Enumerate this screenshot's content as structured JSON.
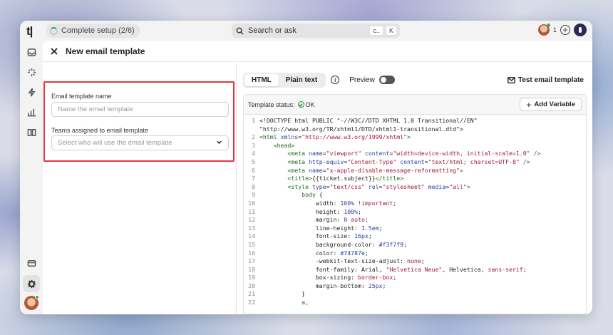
{
  "topbar": {
    "logo": "t|",
    "setup_label": "Complete setup (2/6)",
    "search_label": "Search or ask",
    "search_key1": "c..",
    "search_key2": "K",
    "notification_count": "1"
  },
  "panel": {
    "title": "New email template"
  },
  "form": {
    "name_label": "Email template name",
    "name_placeholder": "Name the email template",
    "teams_label": "Teams assigned to email template",
    "teams_placeholder": "Select who will use the email template"
  },
  "editor": {
    "tabs": [
      "HTML",
      "Plain text"
    ],
    "active_tab": "HTML",
    "preview_label": "Preview",
    "preview_enabled": false,
    "test_button": "Test email template",
    "status_label": "Template status:",
    "status_value": "OK",
    "add_variable_label": "Add Variable"
  },
  "code_lines": [
    {
      "n": "1",
      "segs": [
        [
          "<!DOCTYPE html PUBLIC \"-//W3C//DTD XHTML 1.0 Transitional//EN\"",
          "lc"
        ]
      ]
    },
    {
      "n": "",
      "segs": [
        [
          "\"http://www.w3.org/TR/xhtml1/DTD/xhtml1-transitional.dtd\">",
          "lc"
        ]
      ]
    },
    {
      "n": "2",
      "segs": [
        [
          "<html ",
          "t"
        ],
        [
          "xmlns",
          "a"
        ],
        [
          "=",
          "lc"
        ],
        [
          "\"http://www.w3.org/1999/xhtml\"",
          "s"
        ],
        [
          ">",
          "t"
        ]
      ]
    },
    {
      "n": "3",
      "segs": [
        [
          "    <head>",
          "t"
        ]
      ]
    },
    {
      "n": "4",
      "segs": [
        [
          "        <meta ",
          "t"
        ],
        [
          "name",
          "a"
        ],
        [
          "=",
          "lc"
        ],
        [
          "\"viewport\"",
          "s"
        ],
        [
          " content",
          "a"
        ],
        [
          "=",
          "lc"
        ],
        [
          "\"width=device-width, initial-scale=1.0\"",
          "s"
        ],
        [
          " />",
          "t"
        ]
      ]
    },
    {
      "n": "5",
      "segs": [
        [
          "        <meta ",
          "t"
        ],
        [
          "http-equiv",
          "a"
        ],
        [
          "=",
          "lc"
        ],
        [
          "\"Content-Type\"",
          "s"
        ],
        [
          " content",
          "a"
        ],
        [
          "=",
          "lc"
        ],
        [
          "\"text/html; charset=UTF-8\"",
          "s"
        ],
        [
          " />",
          "t"
        ]
      ]
    },
    {
      "n": "6",
      "segs": [
        [
          "        <meta ",
          "t"
        ],
        [
          "name",
          "a"
        ],
        [
          "=",
          "lc"
        ],
        [
          "\"x-apple-disable-message-reformatting\"",
          "s"
        ],
        [
          ">",
          "t"
        ]
      ]
    },
    {
      "n": "7",
      "segs": [
        [
          "        <title>",
          "t"
        ],
        [
          "{{ticket.subject}}",
          "lc"
        ],
        [
          "</title>",
          "t"
        ]
      ]
    },
    {
      "n": "8",
      "segs": [
        [
          "        <style ",
          "t"
        ],
        [
          "type",
          "a"
        ],
        [
          "=",
          "lc"
        ],
        [
          "\"text/css\"",
          "s"
        ],
        [
          " rel",
          "a"
        ],
        [
          "=",
          "lc"
        ],
        [
          "\"stylesheet\"",
          "s"
        ],
        [
          " media",
          "a"
        ],
        [
          "=",
          "lc"
        ],
        [
          "\"all\"",
          "s"
        ],
        [
          ">",
          "t"
        ]
      ]
    },
    {
      "n": "9",
      "segs": [
        [
          "            body",
          "t"
        ],
        [
          " {",
          "lc"
        ]
      ]
    },
    {
      "n": "10",
      "segs": [
        [
          "                width: ",
          "lc"
        ],
        [
          "100%",
          "v"
        ],
        [
          " !important",
          "s"
        ],
        [
          ";",
          "lc"
        ]
      ]
    },
    {
      "n": "11",
      "segs": [
        [
          "                height: ",
          "lc"
        ],
        [
          "100%",
          "v"
        ],
        [
          ";",
          "lc"
        ]
      ]
    },
    {
      "n": "12",
      "segs": [
        [
          "                margin: ",
          "lc"
        ],
        [
          "0",
          "v"
        ],
        [
          " auto",
          "s"
        ],
        [
          ";",
          "lc"
        ]
      ]
    },
    {
      "n": "13",
      "segs": [
        [
          "                line-height: ",
          "lc"
        ],
        [
          "1.5em",
          "v"
        ],
        [
          ";",
          "lc"
        ]
      ]
    },
    {
      "n": "14",
      "segs": [
        [
          "                font-size: ",
          "lc"
        ],
        [
          "16px",
          "v"
        ],
        [
          ";",
          "lc"
        ]
      ]
    },
    {
      "n": "15",
      "segs": [
        [
          "                background-color: ",
          "lc"
        ],
        [
          "#f3f7f9",
          "v"
        ],
        [
          ";",
          "lc"
        ]
      ]
    },
    {
      "n": "16",
      "segs": [
        [
          "                color: ",
          "lc"
        ],
        [
          "#74787e",
          "v"
        ],
        [
          ";",
          "lc"
        ]
      ]
    },
    {
      "n": "17",
      "segs": [
        [
          "                -webkit-text-size-adjust: ",
          "lc"
        ],
        [
          "none",
          "s"
        ],
        [
          ";",
          "lc"
        ]
      ]
    },
    {
      "n": "18",
      "segs": [
        [
          "                font-family: Arial, ",
          "lc"
        ],
        [
          "\"Helvetica Neue\"",
          "s"
        ],
        [
          ", Helvetica, ",
          "lc"
        ],
        [
          "sans-serif",
          "s"
        ],
        [
          ";",
          "lc"
        ]
      ]
    },
    {
      "n": "19",
      "segs": [
        [
          "                box-sizing: ",
          "lc"
        ],
        [
          "border-box",
          "s"
        ],
        [
          ";",
          "lc"
        ]
      ]
    },
    {
      "n": "20",
      "segs": [
        [
          "                margin-bottom: ",
          "lc"
        ],
        [
          "25px",
          "v"
        ],
        [
          ";",
          "lc"
        ]
      ]
    },
    {
      "n": "21",
      "segs": [
        [
          "            }",
          "lc"
        ]
      ]
    },
    {
      "n": "22",
      "segs": [
        [
          "            a",
          "t"
        ],
        [
          ",",
          "lc"
        ]
      ]
    }
  ]
}
